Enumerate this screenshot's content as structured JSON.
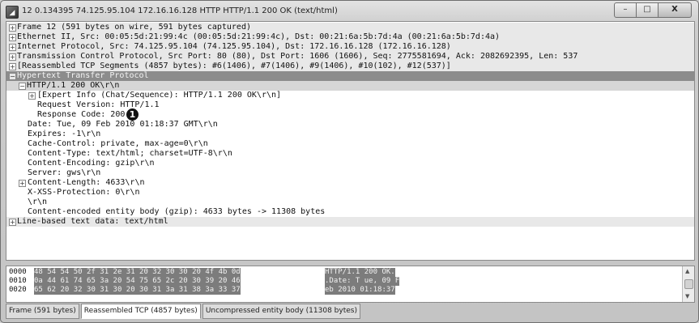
{
  "window": {
    "title": "12 0.134395 74.125.95.104 172.16.16.128 HTTP HTTP/1.1 200 OK (text/html)",
    "icon_name": "wireshark-app-icon",
    "minimize": "–",
    "maximize": "□",
    "close": "X"
  },
  "tree": {
    "rows": [
      {
        "text": "Frame 12 (591 bytes on wire, 591 bytes captured)",
        "expander": "+"
      },
      {
        "text": "Ethernet II, Src: 00:05:5d:21:99:4c (00:05:5d:21:99:4c), Dst: 00:21:6a:5b:7d:4a (00:21:6a:5b:7d:4a)",
        "expander": "+"
      },
      {
        "text": "Internet Protocol, Src: 74.125.95.104 (74.125.95.104), Dst: 172.16.16.128 (172.16.16.128)",
        "expander": "+"
      },
      {
        "text": "Transmission Control Protocol, Src Port: 80 (80), Dst Port: 1606 (1606), Seq: 2775581694, Ack: 2082692395, Len: 537",
        "expander": "+"
      },
      {
        "text": "[Reassembled TCP Segments (4857 bytes): #6(1406), #7(1406), #9(1406), #10(102), #12(537)]",
        "expander": "+"
      },
      {
        "text": "Hypertext Transfer Protocol",
        "expander": "−"
      },
      {
        "text": "HTTP/1.1 200 OK\\r\\n",
        "expander": "−"
      },
      {
        "text": "[Expert Info (Chat/Sequence): HTTP/1.1 200 OK\\r\\n]",
        "expander": "+"
      },
      {
        "text": "Request Version: HTTP/1.1",
        "expander": ""
      },
      {
        "text": "Response Code: 200",
        "expander": ""
      },
      {
        "text": "Date: Tue, 09 Feb 2010 01:18:37 GMT\\r\\n",
        "expander": ""
      },
      {
        "text": "Expires: -1\\r\\n",
        "expander": ""
      },
      {
        "text": "Cache-Control: private, max-age=0\\r\\n",
        "expander": ""
      },
      {
        "text": "Content-Type: text/html; charset=UTF-8\\r\\n",
        "expander": ""
      },
      {
        "text": "Content-Encoding: gzip\\r\\n",
        "expander": ""
      },
      {
        "text": "Server: gws\\r\\n",
        "expander": ""
      },
      {
        "text": "Content-Length: 4633\\r\\n",
        "expander": "+"
      },
      {
        "text": "X-XSS-Protection: 0\\r\\n",
        "expander": ""
      },
      {
        "text": "\\r\\n",
        "expander": ""
      },
      {
        "text": "Content-encoded entity body (gzip): 4633 bytes -> 11308 bytes",
        "expander": ""
      },
      {
        "text": "Line-based text data: text/html",
        "expander": "+"
      }
    ],
    "callout": "1"
  },
  "hex": {
    "rows": [
      {
        "offset": "0000",
        "bytes": "48 54 54 50 2f 31 2e 31  20 32 30 30 20 4f 4b 0d",
        "ascii": "HTTP/1.1  200 OK."
      },
      {
        "offset": "0010",
        "bytes": "0a 44 61 74 65 3a 20 54  75 65 2c 20 30 39 20 46",
        "ascii": ".Date: T ue, 09 F"
      },
      {
        "offset": "0020",
        "bytes": "65 62 20 32 30 31 30 20  30 31 3a 31 38 3a 33 37",
        "ascii": "eb 2010  01:18:37"
      }
    ]
  },
  "tabs": [
    {
      "label": "Frame (591 bytes)"
    },
    {
      "label": "Reassembled TCP (4857 bytes)"
    },
    {
      "label": "Uncompressed entity body (11308 bytes)"
    }
  ],
  "colors": {
    "selected_row": "#8c8c8c",
    "top_level_row": "#e8e8e8",
    "hex_highlight": "#7c7c7c"
  }
}
